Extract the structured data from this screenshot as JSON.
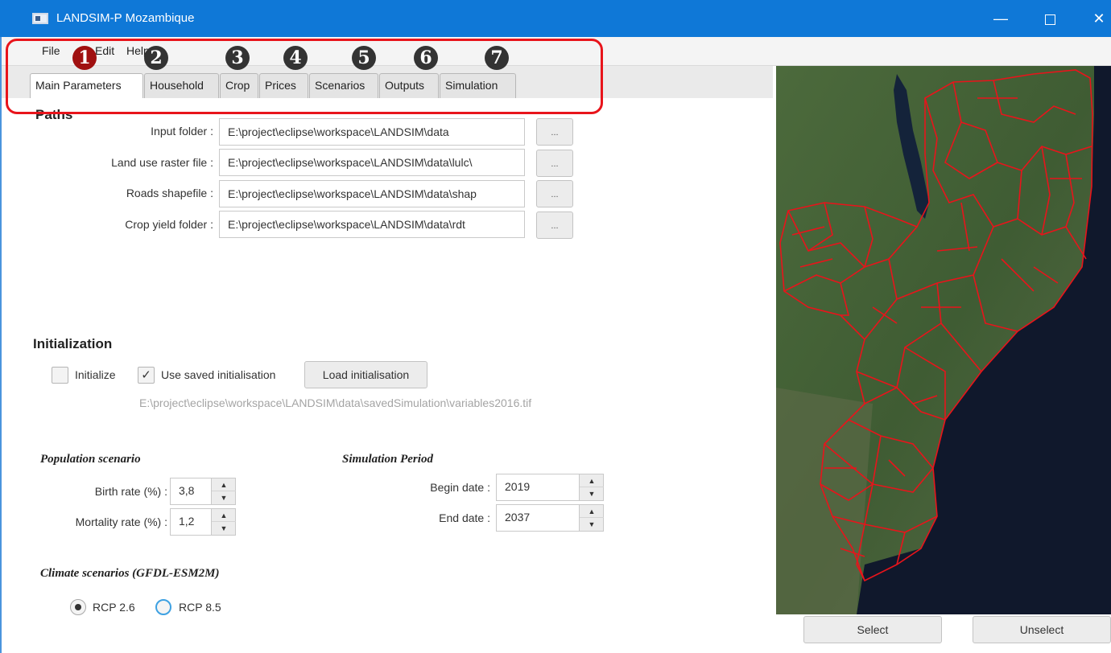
{
  "window": {
    "title": "LANDSIM-P Mozambique",
    "minimize": "—",
    "close": "✕"
  },
  "menu": {
    "file": "File",
    "edit": "Edit",
    "help": "Help"
  },
  "tabs": [
    {
      "label": "Main Parameters",
      "active": true
    },
    {
      "label": "Household"
    },
    {
      "label": "Crop"
    },
    {
      "label": "Prices"
    },
    {
      "label": "Scenarios"
    },
    {
      "label": "Outputs"
    },
    {
      "label": "Simulation"
    }
  ],
  "badges": [
    "1",
    "2",
    "3",
    "4",
    "5",
    "6",
    "7"
  ],
  "paths": {
    "title": "Paths",
    "fields": [
      {
        "label": "Input folder :",
        "value": "E:\\project\\eclipse\\workspace\\LANDSIM\\data",
        "button": "..."
      },
      {
        "label": "Land use raster file :",
        "value": "E:\\project\\eclipse\\workspace\\LANDSIM\\data\\lulc\\",
        "button": "..."
      },
      {
        "label": "Roads shapefile :",
        "value": "E:\\project\\eclipse\\workspace\\LANDSIM\\data\\shap",
        "button": "..."
      },
      {
        "label": "Crop yield folder :",
        "value": "E:\\project\\eclipse\\workspace\\LANDSIM\\data\\rdt",
        "button": "..."
      }
    ]
  },
  "initialization": {
    "title": "Initialization",
    "initialize_label": "Initialize",
    "initialize_checked": false,
    "use_saved_label": "Use saved initialisation",
    "use_saved_checked": true,
    "load_button": "Load initialisation",
    "saved_path": "E:\\project\\eclipse\\workspace\\LANDSIM\\data\\savedSimulation\\variables2016.tif"
  },
  "population": {
    "title": "Population scenario",
    "birth_label": "Birth rate (%) :",
    "birth_value": "3,8",
    "mortality_label": "Mortality rate (%) :",
    "mortality_value": "1,2"
  },
  "simulation_period": {
    "title": "Simulation Period",
    "begin_label": "Begin date :",
    "begin_value": "2019",
    "end_label": "End date :",
    "end_value": "2037"
  },
  "climate": {
    "title": "Climate scenarios (GFDL-ESM2M)",
    "options": [
      {
        "label": "RCP 2.6",
        "selected": true
      },
      {
        "label": "RCP 8.5",
        "selected": false
      }
    ]
  },
  "map": {
    "select_button": "Select",
    "unselect_button": "Unselect",
    "boundary_color": "#e8141b"
  },
  "colors": {
    "titlebar": "#0f78d7",
    "highlight": "#e8141b",
    "badge_first": "#a01010",
    "badge_rest": "#333333"
  }
}
